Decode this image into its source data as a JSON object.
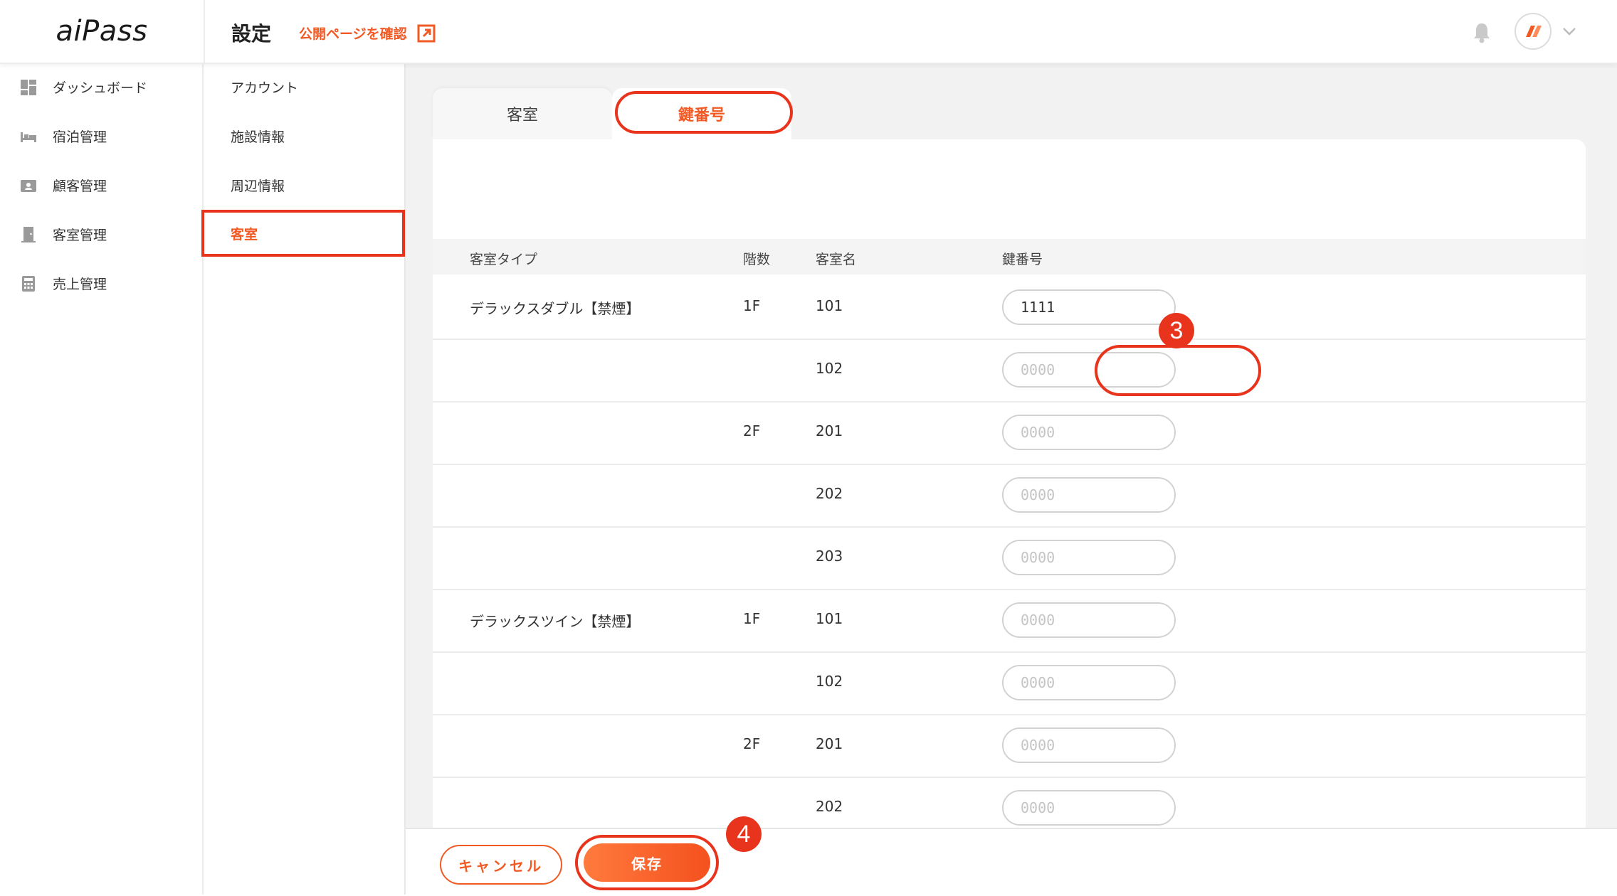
{
  "app": {
    "logo": "aiPass"
  },
  "header": {
    "title": "設定",
    "public_link": "公開ページを確認"
  },
  "sidebar": {
    "items": [
      {
        "label": "ダッシュボード",
        "icon": "dashboard-icon"
      },
      {
        "label": "宿泊管理",
        "icon": "bed-icon"
      },
      {
        "label": "顧客管理",
        "icon": "customer-card-icon"
      },
      {
        "label": "客室管理",
        "icon": "door-icon"
      },
      {
        "label": "売上管理",
        "icon": "calculator-icon"
      }
    ]
  },
  "settings_menu": {
    "items": [
      {
        "label": "アカウント"
      },
      {
        "label": "施設情報"
      },
      {
        "label": "周辺情報"
      },
      {
        "label": "客室"
      }
    ]
  },
  "tabs": [
    {
      "label": "客室"
    },
    {
      "label": "鍵番号"
    }
  ],
  "table": {
    "headers": {
      "type": "客室タイプ",
      "floor": "階数",
      "room": "客室名",
      "key": "鍵番号"
    },
    "key_placeholder": "0000",
    "rows": [
      {
        "type": "デラックスダブル【禁煙】",
        "floor": "1F",
        "room": "101",
        "key": "1111"
      },
      {
        "type": "",
        "floor": "",
        "room": "102",
        "key": ""
      },
      {
        "type": "",
        "floor": "2F",
        "room": "201",
        "key": ""
      },
      {
        "type": "",
        "floor": "",
        "room": "202",
        "key": ""
      },
      {
        "type": "",
        "floor": "",
        "room": "203",
        "key": ""
      },
      {
        "type": "デラックスツイン【禁煙】",
        "floor": "1F",
        "room": "101",
        "key": ""
      },
      {
        "type": "",
        "floor": "",
        "room": "102",
        "key": ""
      },
      {
        "type": "",
        "floor": "2F",
        "room": "201",
        "key": ""
      },
      {
        "type": "",
        "floor": "",
        "room": "202",
        "key": ""
      }
    ]
  },
  "annotations": {
    "step3": "3",
    "step4": "4"
  },
  "footer": {
    "cancel": "キャンセル",
    "save": "保存"
  },
  "colors": {
    "accent": "#f15a24",
    "highlight": "#e8331d"
  }
}
